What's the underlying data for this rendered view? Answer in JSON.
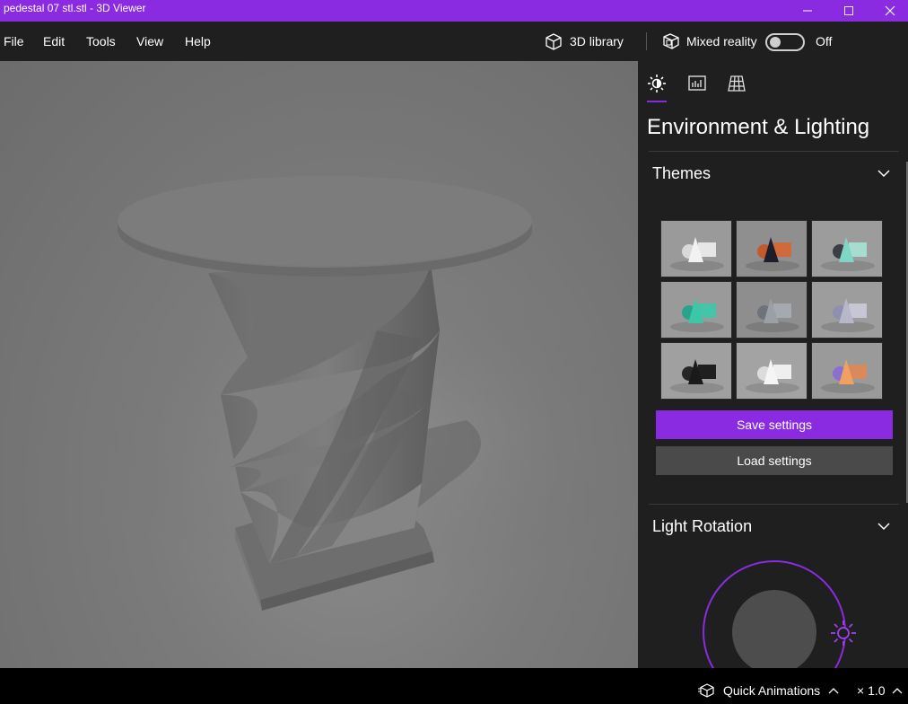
{
  "window": {
    "title": "pedestal 07 stl.stl - 3D Viewer",
    "accent": "#8a2be2"
  },
  "menu": {
    "items": [
      "File",
      "Edit",
      "Tools",
      "View",
      "Help"
    ],
    "library_label": "3D library",
    "mixed_reality_label": "Mixed reality",
    "mixed_reality_state": "Off"
  },
  "panel": {
    "tabs": [
      "sun-icon",
      "stats-icon",
      "grid-icon"
    ],
    "title": "Environment & Lighting",
    "themes_title": "Themes",
    "save_label": "Save settings",
    "load_label": "Load settings",
    "light_rotation_title": "Light Rotation",
    "themes": [
      {
        "bg": "#9a9a9a",
        "cone": "#f2f2f2",
        "sphere": "#d9d9d9",
        "box": "#e6e6e6"
      },
      {
        "bg": "#8f8f8f",
        "cone": "#1e1e2a",
        "sphere": "#c25a2b",
        "box": "#d06a3a"
      },
      {
        "bg": "#9c9c9c",
        "cone": "#7fd6c4",
        "sphere": "#3b3f45",
        "box": "#a7ddd0"
      },
      {
        "bg": "#9a9a9a",
        "cone": "#3bc7a8",
        "sphere": "#2aa38a",
        "box": "#46c4a9"
      },
      {
        "bg": "#8e8e8e",
        "cone": "#9aa0a6",
        "sphere": "#6d7379",
        "box": "#a4aaaf"
      },
      {
        "bg": "#9d9d9d",
        "cone": "#b7b7c9",
        "sphere": "#8f8fb0",
        "box": "#c6c6d4"
      },
      {
        "bg": "#a0a0a0",
        "cone": "#1a1a1a",
        "sphere": "#262626",
        "box": "#1f1f1f"
      },
      {
        "bg": "#a3a3a3",
        "cone": "#f5f5f5",
        "sphere": "#dcdcdc",
        "box": "#efefef"
      },
      {
        "bg": "#9a9a9a",
        "cone": "#f0a060",
        "sphere": "#8a6fd0",
        "box": "#d88a5c"
      }
    ]
  },
  "bottom": {
    "quick_animations_label": "Quick Animations",
    "speed_label": "× 1.0"
  }
}
